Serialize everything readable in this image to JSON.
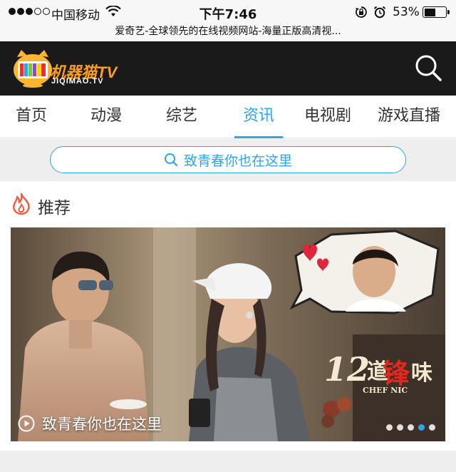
{
  "status_bar": {
    "carrier": "中国移动",
    "time": "下午7:46",
    "battery_percent": "53%",
    "battery_level": 0.53,
    "page_title": "爱奇艺-全球领先的在线视频网站-海量正版高清视..."
  },
  "header": {
    "logo_text": "机器猫TV",
    "logo_subtext": "JIQIMAO.TV",
    "search_icon": "search-icon"
  },
  "tabs": [
    {
      "label": "首页"
    },
    {
      "label": "动漫"
    },
    {
      "label": "综艺"
    },
    {
      "label": "资讯",
      "active": true
    },
    {
      "label": "电视剧"
    },
    {
      "label": "游戏直播"
    }
  ],
  "search": {
    "text": "致青春你也在这里"
  },
  "recommend": {
    "title": "推荐",
    "icon": "flame-icon"
  },
  "banner": {
    "caption": "致青春你也在这里",
    "logo_text": "12道锋味",
    "logo_sub": "CHEF NIC",
    "slide_count": 5,
    "active_slide": 3
  },
  "colors": {
    "accent": "#2fa5e6",
    "header_bg": "#1a1a1a",
    "logo_orange": "#ff9f1a",
    "flame": "#f15a3c"
  }
}
